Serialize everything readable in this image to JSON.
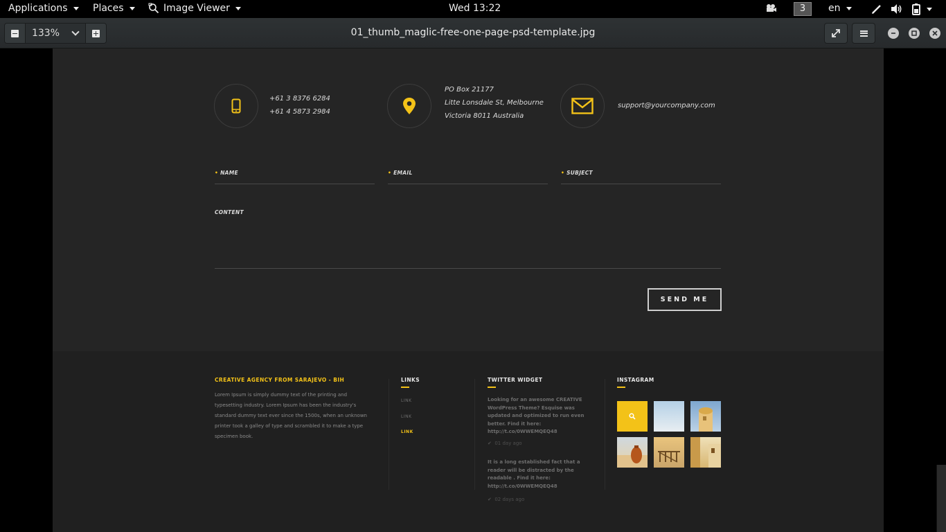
{
  "topbar": {
    "applications": "Applications",
    "places": "Places",
    "image_viewer": "Image Viewer",
    "clock": "Wed 13:22",
    "workspace": "3",
    "language": "en"
  },
  "header": {
    "zoom": "133%",
    "title": "01_thumb_maglic-free-one-page-psd-template.jpg"
  },
  "image": {
    "contact": {
      "phone_lines": [
        "+61 3 8376 6284",
        "+61 4 5873 2984"
      ],
      "address_lines": [
        "PO Box 21177",
        "Litte Lonsdale St, Melbourne",
        "Victoria 8011 Australia"
      ],
      "email": "support@yourcompany.com",
      "form": {
        "name_label": "NAME",
        "email_label": "EMAIL",
        "subject_label": "SUBJECT",
        "content_label": "CONTENT",
        "send_label": "SEND ME"
      }
    },
    "footer": {
      "about_title": "CREATIVE AGENCY FROM SARAJEVO - BIH",
      "about_text": "Lorem Ipsum is simply dummy text of the printing and typesetting industry. Lorem Ipsum has been the industry's standard dummy text ever since the 1500s, when an unknown printer took a galley of type and scrambled it to make a type specimen book.",
      "links_title": "LINKS",
      "links": [
        "LINK",
        "LINK",
        "LINK"
      ],
      "twitter_title": "TWITTER WIDGET",
      "tweets": [
        {
          "text": "Looking for an awesome CREATIVE WordPress Theme? Esquise was updated and optimized to run even better. Find it here: http://t.co/0WWEMQEQ48",
          "time": "01 day ago"
        },
        {
          "text": "It is a long established fact that a reader will be distracted by the readable . Find it here: http://t.co/0WWEMQEQ48",
          "time": "02 days ago"
        }
      ],
      "instagram_title": "INSTAGRAM"
    }
  },
  "colors": {
    "accent": "#f3c218",
    "contact_bg": "#252525",
    "footer_bg": "#202020"
  }
}
